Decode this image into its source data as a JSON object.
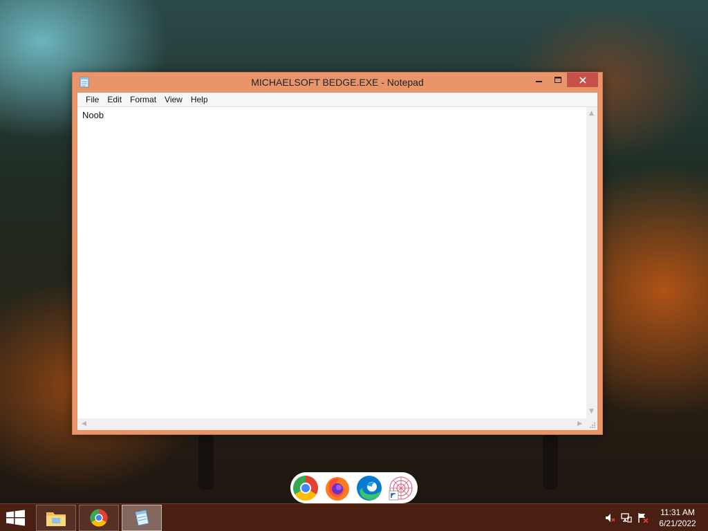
{
  "window": {
    "title": "MICHAELSOFT BEDGE.EXE - Notepad",
    "app_icon": "notepad-icon",
    "controls": {
      "minimize": "minimize-icon",
      "maximize": "maximize-icon",
      "close": "close-icon"
    },
    "close_color": "#c7504b",
    "frame_color": "#e8956b"
  },
  "menu": {
    "items": [
      "File",
      "Edit",
      "Format",
      "View",
      "Help"
    ]
  },
  "editor": {
    "content": "Noob"
  },
  "dock": {
    "icons": [
      "chrome-icon",
      "firefox-icon",
      "edge-icon",
      "spiral-shortcut-icon"
    ]
  },
  "taskbar": {
    "start_icon": "windows-logo-icon",
    "items": [
      "file-explorer-icon",
      "chrome-icon",
      "notepad-icon"
    ],
    "active_item": "notepad-icon",
    "tray": [
      "volume-muted-icon",
      "network-icon",
      "action-center-flag-icon"
    ],
    "time": "11:31 AM",
    "date": "6/21/2022"
  }
}
